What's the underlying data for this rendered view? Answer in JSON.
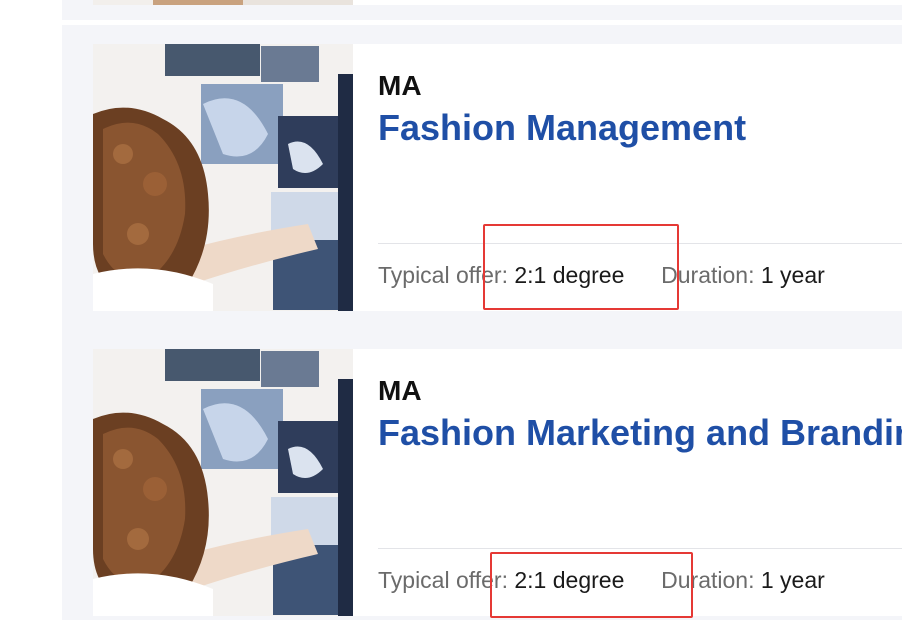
{
  "courses": [
    {
      "level": "MA",
      "title": "Fashion Management",
      "offer_label": "Typical offer:",
      "offer_value": "2:1 degree",
      "duration_label": "Duration:",
      "duration_value": "1 year"
    },
    {
      "level": "MA",
      "title": "Fashion Marketing and Branding",
      "offer_label": "Typical offer:",
      "offer_value": "2:1 degree",
      "duration_label": "Duration:",
      "duration_value": "1 year"
    }
  ],
  "colors": {
    "title_blue": "#1f4fa6",
    "annotation_red": "#e53935",
    "page_shade": "#f4f5f9"
  },
  "icons": [
    "course-thumbnail-image"
  ]
}
